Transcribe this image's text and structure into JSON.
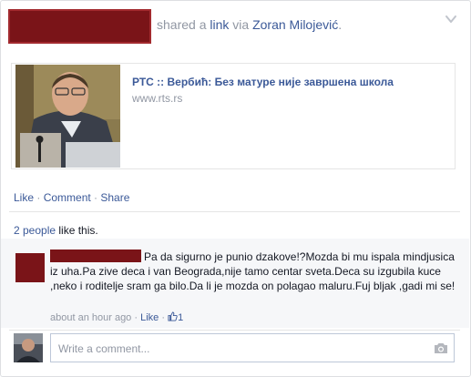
{
  "post": {
    "header_shared": "shared a",
    "header_link_word": "link",
    "header_via": "via",
    "header_via_name": "Zoran Milojević",
    "header_period": "."
  },
  "link_preview": {
    "title": "РТС :: Вербић: Без матуре није завршена школа",
    "domain": "www.rts.rs"
  },
  "actions": {
    "like": "Like",
    "sep1": " · ",
    "comment": "Comment",
    "sep2": " · ",
    "share": "Share"
  },
  "likes": {
    "people": "2 people",
    "rest": " like this."
  },
  "comment": {
    "text": "Pa da sigurno je punio dzakove!?Mozda bi mu ispala mindjusica iz uha.Pa zive deca i van Beograda,nije tamo centar sveta.Deca su izgubila kuce ,neko i roditelje sram ga bilo.Da li je mozda on polagao maluru.Fuj bljak ,gadi mi se!",
    "time": "about an hour ago",
    "dot": " · ",
    "like": "Like",
    "dot2": " · ",
    "like_count": "1"
  },
  "composer": {
    "placeholder": "Write a comment..."
  },
  "colors": {
    "link": "#3b5998",
    "muted": "#9197a3",
    "redaction": "#7a1418"
  },
  "icons": {
    "chevron": "chevron-down-icon",
    "thumb": "thumbs-up-icon",
    "camera": "camera-icon"
  }
}
